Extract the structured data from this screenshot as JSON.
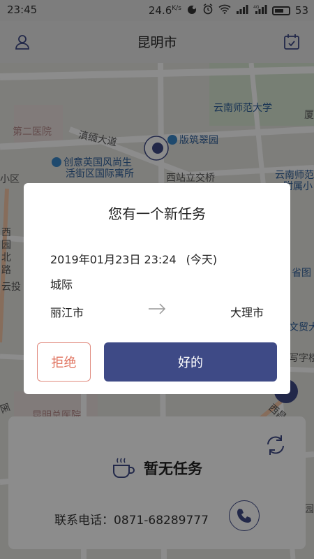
{
  "status_bar": {
    "time": "23:45",
    "network_speed": "24.6",
    "network_speed_unit": "K/s",
    "battery": "53",
    "icons": [
      "cat-app-icon",
      "alarm-icon",
      "wifi-icon",
      "signal-icon",
      "4g-signal-icon",
      "battery-icon"
    ]
  },
  "header": {
    "title": "昆明市",
    "left_icon": "user-icon",
    "right_icon": "calendar-check-icon"
  },
  "map": {
    "labels": [
      "第二医院",
      "滇缅大道",
      "版筑翠园",
      "云南师范大学",
      "创意英国风尚生",
      "活街区国际寓所",
      "西站立交桥",
      "小区",
      "西",
      "园",
      "北",
      "路",
      "云投",
      "云南师范",
      "附属小",
      "省图",
      "文贸大",
      "写字楼",
      "昆明总医院",
      "西昌",
      "厦",
      "医",
      "园"
    ]
  },
  "dialog": {
    "title": "您有一个新任务",
    "datetime": "2019年01月23日 23:24",
    "day_label": "(今天)",
    "trip_type": "城际",
    "from_city": "丽江市",
    "to_city": "大理市",
    "reject_label": "拒绝",
    "ok_label": "好的"
  },
  "bottom_card": {
    "status_text": "暂无任务",
    "contact_text": "联系电话：0871-68289777",
    "icons": [
      "refresh-icon",
      "coffee-cup-icon",
      "phone-icon"
    ]
  },
  "colors": {
    "accent": "#3e4a86",
    "reject": "#e0735f",
    "overlay": "rgba(0,0,0,0.45)"
  }
}
